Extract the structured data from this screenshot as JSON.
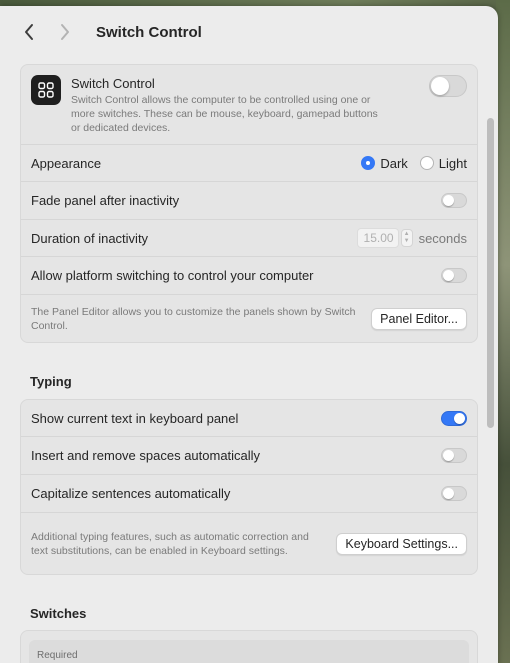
{
  "window": {
    "title": "Switch Control"
  },
  "switch_control": {
    "title": "Switch Control",
    "description": "Switch Control allows the computer to be controlled using one or more switches. These can be mouse, keyboard, gamepad buttons or dedicated devices.",
    "enabled": false
  },
  "appearance": {
    "label": "Appearance",
    "options": [
      "Dark",
      "Light"
    ],
    "selected": "Dark"
  },
  "fade_panel": {
    "label": "Fade panel after inactivity",
    "enabled": false
  },
  "duration": {
    "label": "Duration of inactivity",
    "value": "15.00",
    "unit": "seconds"
  },
  "platform_switching": {
    "label": "Allow platform switching to control your computer",
    "enabled": false
  },
  "panel_editor": {
    "text": "The Panel Editor allows you to customize the panels shown by Switch Control.",
    "button": "Panel Editor..."
  },
  "typing": {
    "title": "Typing",
    "show_text": {
      "label": "Show current text in keyboard panel",
      "enabled": true
    },
    "spaces": {
      "label": "Insert and remove spaces automatically",
      "enabled": false
    },
    "capitalize": {
      "label": "Capitalize sentences automatically",
      "enabled": false
    },
    "footer_text": "Additional typing features, such as automatic correction and text substitutions, can be enabled in Keyboard settings.",
    "button": "Keyboard Settings..."
  },
  "switches": {
    "title": "Switches",
    "required_label": "Required"
  },
  "colors": {
    "accent": "#3478f6"
  }
}
